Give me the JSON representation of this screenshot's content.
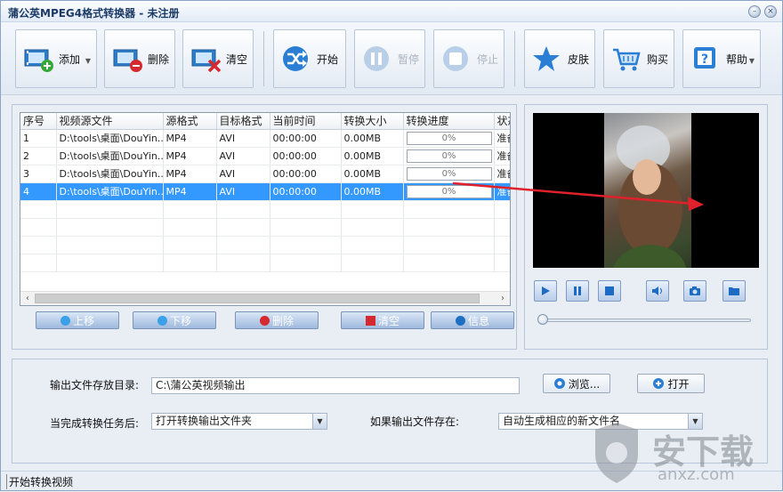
{
  "window": {
    "title": "蒲公英MPEG4格式转换器 - 未注册"
  },
  "toolbar": {
    "add_label": "添加",
    "delete_label": "删除",
    "clear_label": "清空",
    "start_label": "开始",
    "pause_label": "暂停",
    "stop_label": "停止",
    "skin_label": "皮肤",
    "buy_label": "购买",
    "help_label": "帮助"
  },
  "table": {
    "headers": [
      "序号",
      "视频源文件",
      "源格式",
      "目标格式",
      "当前时间",
      "转换大小",
      "转换进度",
      "状态"
    ],
    "rows": [
      {
        "no": "1",
        "file": "D:\\tools\\桌面\\DouYin...",
        "src": "MP4",
        "dst": "AVI",
        "time": "00:00:00",
        "size": "0.00MB",
        "progress": "0%",
        "status": "准备"
      },
      {
        "no": "2",
        "file": "D:\\tools\\桌面\\DouYin...",
        "src": "MP4",
        "dst": "AVI",
        "time": "00:00:00",
        "size": "0.00MB",
        "progress": "0%",
        "status": "准备"
      },
      {
        "no": "3",
        "file": "D:\\tools\\桌面\\DouYin...",
        "src": "MP4",
        "dst": "AVI",
        "time": "00:00:00",
        "size": "0.00MB",
        "progress": "0%",
        "status": "准备"
      },
      {
        "no": "4",
        "file": "D:\\tools\\桌面\\DouYin...",
        "src": "MP4",
        "dst": "AVI",
        "time": "00:00:00",
        "size": "0.00MB",
        "progress": "0%",
        "status": "准备"
      }
    ],
    "selected_row": 4
  },
  "list_buttons": {
    "up": "上移",
    "down": "下移",
    "delete": "删除",
    "clear": "清空",
    "info": "信息"
  },
  "output": {
    "dir_label": "输出文件存放目录:",
    "dir_value": "C:\\蒲公英视频输出",
    "browse_label": "浏览...",
    "open_label": "打开",
    "after_label": "当完成转换任务后:",
    "after_value": "打开转换输出文件夹",
    "exists_label": "如果输出文件存在:",
    "exists_value": "自动生成相应的新文件名"
  },
  "status": {
    "text": "开始转换视频"
  },
  "watermark": {
    "text": "安下载",
    "sub": "anxz.com"
  },
  "colors": {
    "selection": "#3399ff",
    "accent": "#2a7fd4",
    "annotation_arrow": "#e0202a"
  }
}
